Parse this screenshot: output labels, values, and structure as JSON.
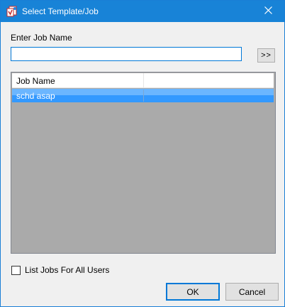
{
  "window": {
    "title": "Select Template/Job",
    "close_icon": "close-icon",
    "app_icon": "app-icon"
  },
  "form": {
    "job_name_label": "Enter Job Name",
    "job_name_value": "",
    "go_button_label": ">>"
  },
  "list": {
    "columns": [
      "Job Name",
      ""
    ],
    "rows": [
      {
        "job_name": "schd asap",
        "selected": true
      }
    ],
    "selection_color": "#3399ff",
    "background_color": "#aaaaaa"
  },
  "options": {
    "all_users_label": "List Jobs For All Users",
    "all_users_checked": false
  },
  "buttons": {
    "ok_label": "OK",
    "cancel_label": "Cancel"
  },
  "colors": {
    "titlebar": "#1883d7",
    "accent": "#0078d7"
  }
}
